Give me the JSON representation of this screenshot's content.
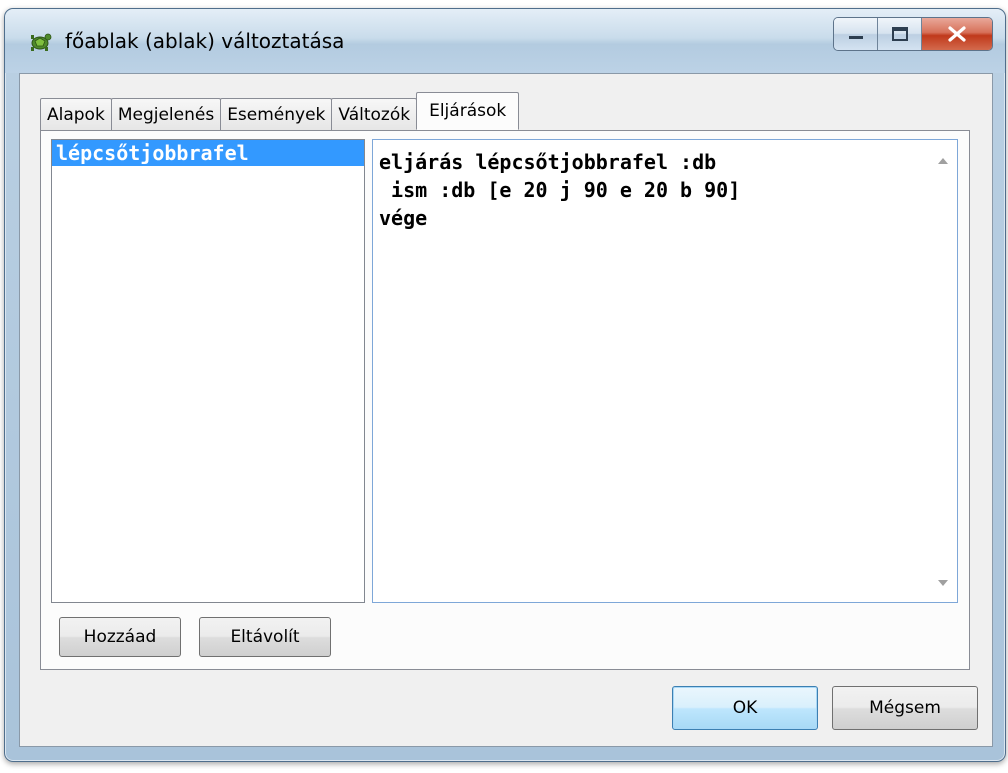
{
  "header_cut_text": "…",
  "window": {
    "title": "főablak (ablak) változtatása",
    "icon": "turtle-app-icon",
    "caption_buttons": [
      "minimize-icon",
      "maximize-icon",
      "close-icon"
    ]
  },
  "tabs": [
    {
      "label": "Alapok",
      "active": false
    },
    {
      "label": "Megjelenés",
      "active": false
    },
    {
      "label": "Események",
      "active": false
    },
    {
      "label": "Változók",
      "active": false
    },
    {
      "label": "Eljárások",
      "active": true
    }
  ],
  "procedures": {
    "items": [
      "lépcsőtjobbrafel"
    ],
    "selected": "lépcsőtjobbrafel",
    "add_button": "Hozzáad",
    "remove_button": "Eltávolít"
  },
  "editor": {
    "code": "eljárás lépcsőtjobbrafel :db\n ism :db [e 20 j 90 e 20 b 90]\nvége"
  },
  "dialog_buttons": {
    "ok": "OK",
    "cancel": "Mégsem"
  },
  "colors": {
    "selection": "#3399ff",
    "default_button_border": "#3c7fb1",
    "close_button": "#c0391b"
  }
}
